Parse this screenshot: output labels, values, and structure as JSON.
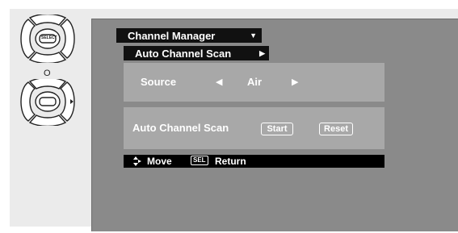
{
  "remote": {
    "select_label": "SELECT",
    "o_label": "O"
  },
  "menu": {
    "title": "Channel Manager",
    "submenu": "Auto Channel Scan",
    "source_label": "Source",
    "source_value": "Air",
    "scan_label": "Auto Channel Scan",
    "start_label": "Start",
    "reset_label": "Reset"
  },
  "hints": {
    "move": "Move",
    "sel": "SEL",
    "return": "Return"
  }
}
